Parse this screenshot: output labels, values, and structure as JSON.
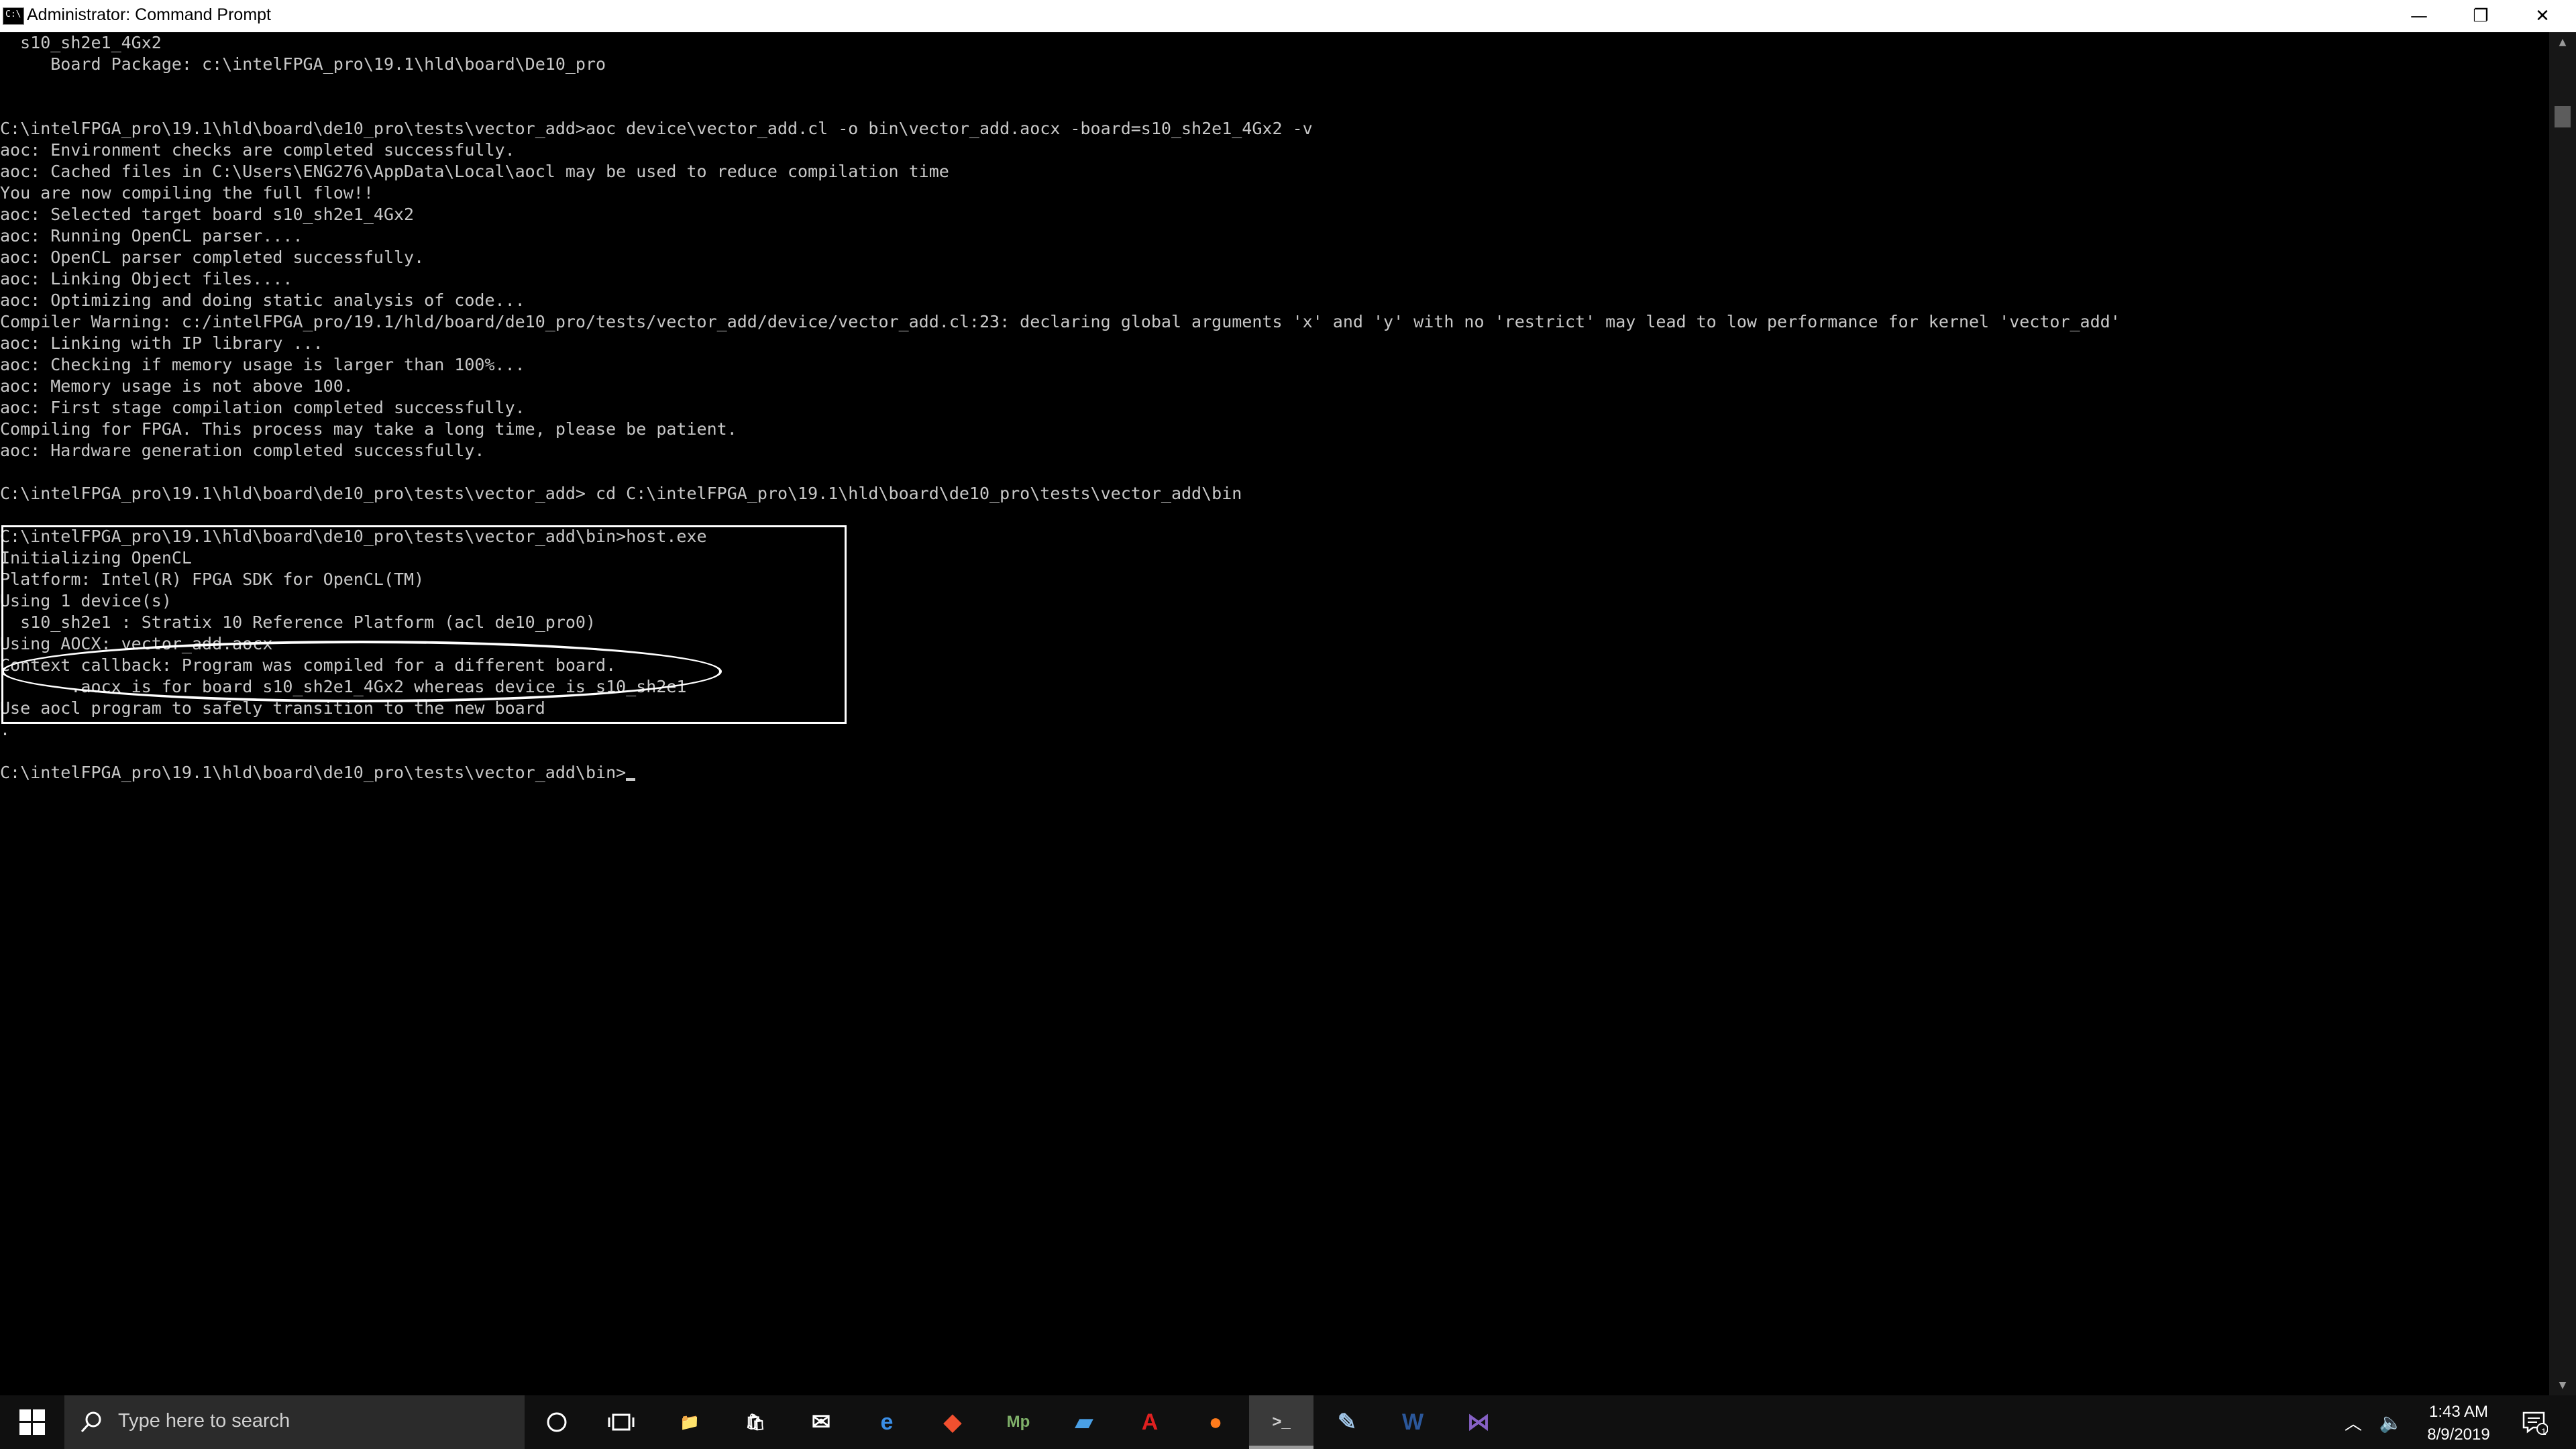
{
  "window": {
    "title": "Administrator: Command Prompt",
    "minimize_glyph": "—",
    "restore_glyph": "❐",
    "close_glyph": "✕"
  },
  "console": {
    "lines": [
      "  s10_sh2e1_4Gx2",
      "     Board Package: c:\\intelFPGA_pro\\19.1\\hld\\board\\De10_pro",
      "",
      "",
      "C:\\intelFPGA_pro\\19.1\\hld\\board\\de10_pro\\tests\\vector_add>aoc device\\vector_add.cl -o bin\\vector_add.aocx -board=s10_sh2e1_4Gx2 -v",
      "aoc: Environment checks are completed successfully.",
      "aoc: Cached files in C:\\Users\\ENG276\\AppData\\Local\\aocl may be used to reduce compilation time",
      "You are now compiling the full flow!!",
      "aoc: Selected target board s10_sh2e1_4Gx2",
      "aoc: Running OpenCL parser....",
      "aoc: OpenCL parser completed successfully.",
      "aoc: Linking Object files....",
      "aoc: Optimizing and doing static analysis of code...",
      "Compiler Warning: c:/intelFPGA_pro/19.1/hld/board/de10_pro/tests/vector_add/device/vector_add.cl:23: declaring global arguments 'x' and 'y' with no 'restrict' may lead to low performance for kernel 'vector_add'",
      "aoc: Linking with IP library ...",
      "aoc: Checking if memory usage is larger than 100%...",
      "aoc: Memory usage is not above 100.",
      "aoc: First stage compilation completed successfully.",
      "Compiling for FPGA. This process may take a long time, please be patient.",
      "aoc: Hardware generation completed successfully.",
      "",
      "C:\\intelFPGA_pro\\19.1\\hld\\board\\de10_pro\\tests\\vector_add> cd C:\\intelFPGA_pro\\19.1\\hld\\board\\de10_pro\\tests\\vector_add\\bin",
      "",
      "C:\\intelFPGA_pro\\19.1\\hld\\board\\de10_pro\\tests\\vector_add\\bin>host.exe",
      "Initializing OpenCL",
      "Platform: Intel(R) FPGA SDK for OpenCL(TM)",
      "Using 1 device(s)",
      "  s10_sh2e1 : Stratix 10 Reference Platform (acl de10_pro0)",
      "Using AOCX: vector_add.aocx",
      "Context callback: Program was compiled for a different board.",
      "       .aocx is for board s10_sh2e1_4Gx2 whereas device is s10_sh2e1",
      "Use aocl program to safely transition to the new board",
      ".",
      "",
      "C:\\intelFPGA_pro\\19.1\\hld\\board\\de10_pro\\tests\\vector_add\\bin>"
    ]
  },
  "taskbar": {
    "search_placeholder": "Type here to search",
    "apps": [
      {
        "name": "file-explorer",
        "glyph": "📁",
        "color": "#f6c342"
      },
      {
        "name": "microsoft-store",
        "glyph": "🛍",
        "color": "#ffffff"
      },
      {
        "name": "mail",
        "glyph": "✉",
        "color": "#ffffff"
      },
      {
        "name": "edge",
        "glyph": "e",
        "color": "#3a8ee6"
      },
      {
        "name": "git",
        "glyph": "◆",
        "color": "#f1502f"
      },
      {
        "name": "mp-lab",
        "glyph": "Mp",
        "color": "#7fb069"
      },
      {
        "name": "remote-desktop",
        "glyph": "▰",
        "color": "#4aa0e6"
      },
      {
        "name": "acrobat",
        "glyph": "A",
        "color": "#e02020"
      },
      {
        "name": "firefox",
        "glyph": "●",
        "color": "#ff7b1c"
      },
      {
        "name": "command-prompt",
        "glyph": ">_",
        "color": "#cccccc"
      },
      {
        "name": "ide",
        "glyph": "✎",
        "color": "#9fc4e6"
      },
      {
        "name": "word",
        "glyph": "W",
        "color": "#2b579a"
      },
      {
        "name": "visual-studio",
        "glyph": "⋈",
        "color": "#8661c5"
      }
    ],
    "time": "1:43 AM",
    "date": "8/9/2019",
    "notification_count": "1"
  }
}
